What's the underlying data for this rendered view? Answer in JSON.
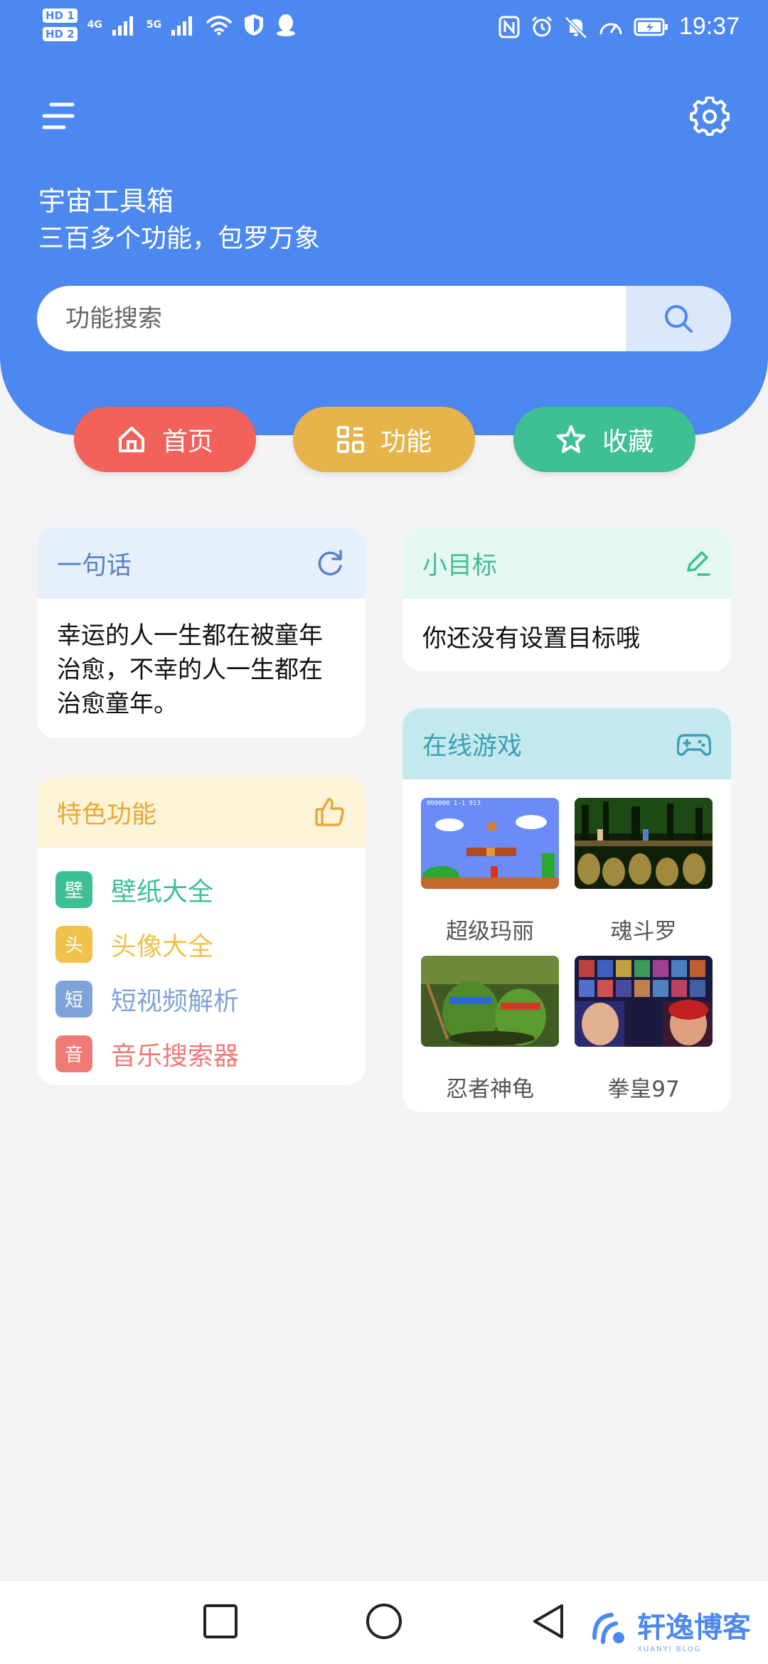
{
  "status_bar": {
    "hd1": "HD 1",
    "hd2": "HD 2",
    "net1": "4G",
    "net2": "5G",
    "time": "19:37"
  },
  "header": {
    "title": "宇宙工具箱",
    "subtitle": "三百多个功能，包罗万象",
    "menu_icon": "menu-icon",
    "settings_icon": "gear-icon"
  },
  "search": {
    "placeholder": "功能搜索"
  },
  "nav_pills": [
    {
      "label": "首页",
      "icon": "home-icon",
      "color": "#f2615a"
    },
    {
      "label": "功能",
      "icon": "grid-icon",
      "color": "#e6b44a"
    },
    {
      "label": "收藏",
      "icon": "star-icon",
      "color": "#3fbf94"
    }
  ],
  "quote_card": {
    "title": "一句话",
    "text": "幸运的人一生都在被童年治愈，不幸的人一生都在治愈童年。"
  },
  "goal_card": {
    "title": "小目标",
    "text": "你还没有设置目标哦"
  },
  "feature_card": {
    "title": "特色功能",
    "items": [
      {
        "badge": "壁",
        "label": "壁纸大全",
        "color": "#3fbf94"
      },
      {
        "badge": "头",
        "label": "头像大全",
        "color": "#f0c24a"
      },
      {
        "badge": "短",
        "label": "短视频解析",
        "color": "#7fa2d8"
      },
      {
        "badge": "音",
        "label": "音乐搜索器",
        "color": "#f07a76"
      }
    ]
  },
  "games_card": {
    "title": "在线游戏",
    "games": [
      {
        "name": "超级玛丽",
        "hud": "000000   1-1   913"
      },
      {
        "name": "魂斗罗"
      },
      {
        "name": "忍者神龟"
      },
      {
        "name": "拳皇97"
      }
    ]
  },
  "watermark": {
    "title": "轩逸博客",
    "sub": "XUANYI BLOG"
  }
}
